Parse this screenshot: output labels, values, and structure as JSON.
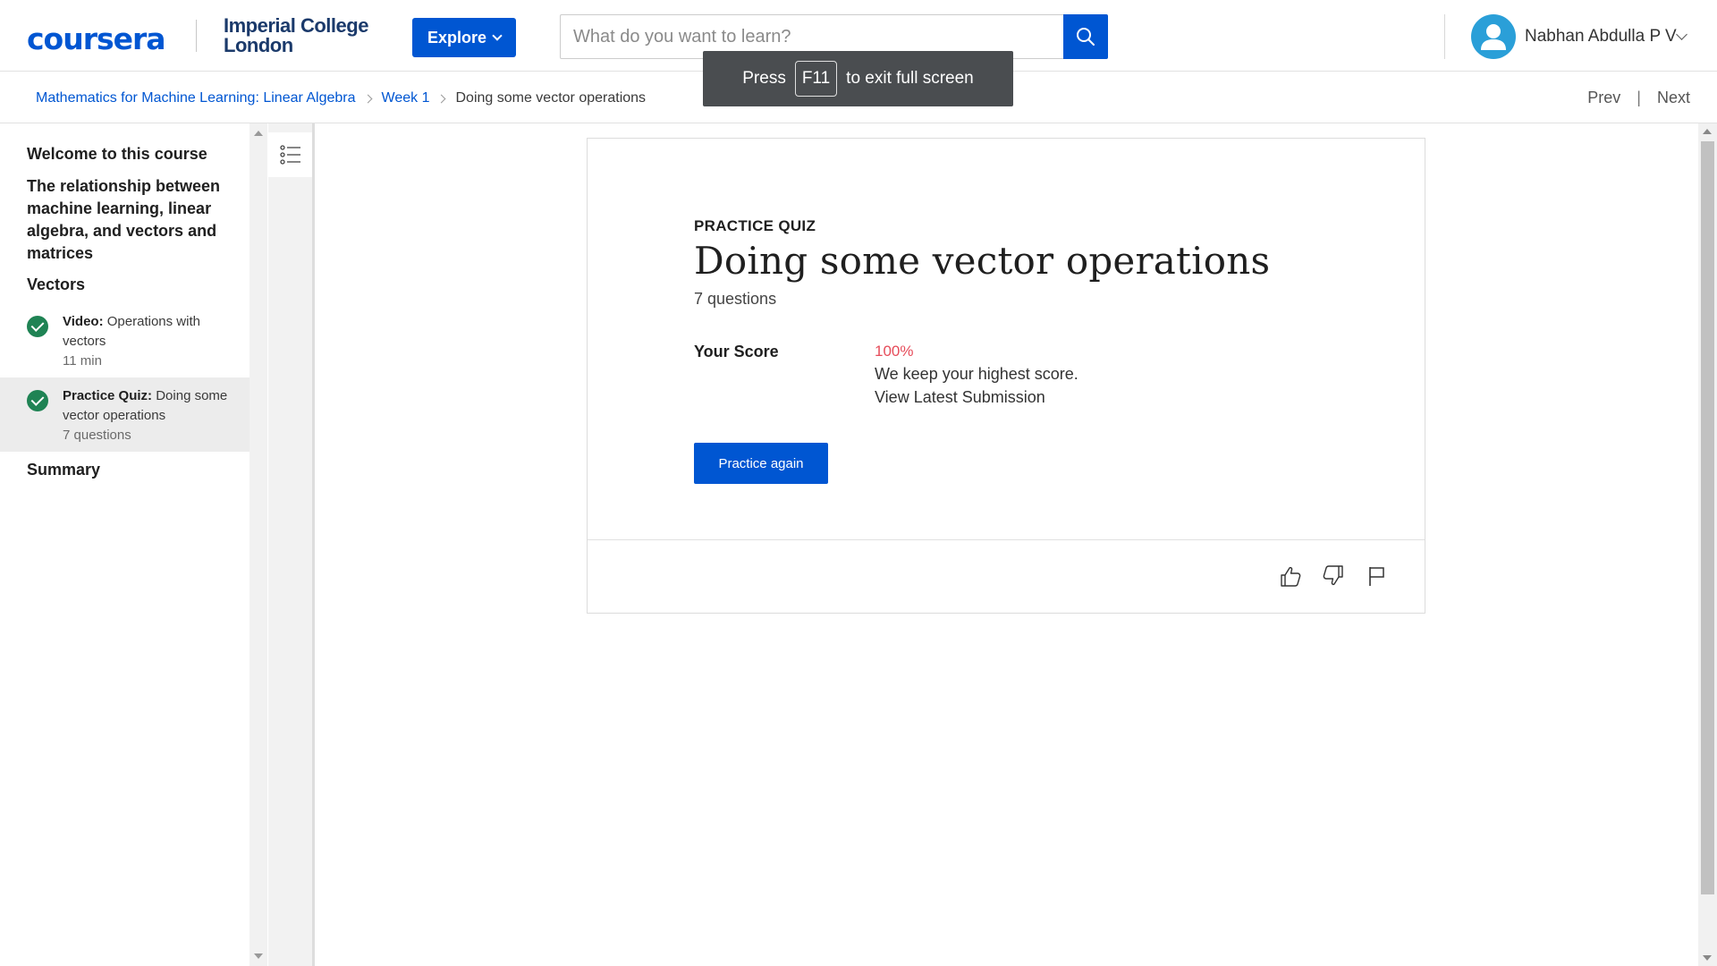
{
  "header": {
    "logo_text": "coursera",
    "partner_line1": "Imperial College",
    "partner_line2": "London",
    "explore_label": "Explore",
    "search_placeholder": "What do you want to learn?",
    "user_name": "Nabhan Abdulla P V"
  },
  "toast": {
    "before": "Press",
    "key": "F11",
    "after": "to exit full screen"
  },
  "breadcrumb": {
    "items": [
      "Mathematics for Machine Learning: Linear Algebra",
      "Week 1",
      "Doing some vector operations"
    ]
  },
  "pager": {
    "prev": "Prev",
    "separator": "|",
    "next": "Next"
  },
  "sidebar": {
    "welcome": "Welcome to this course",
    "section1": "The relationship between machine learning, linear algebra, and vectors and matrices",
    "section2": "Vectors",
    "items": [
      {
        "type": "Video:",
        "title": "Operations with vectors",
        "meta": "11 min",
        "completed": true
      },
      {
        "type": "Practice Quiz:",
        "title": "Doing some vector operations",
        "meta": "7 questions",
        "completed": true
      }
    ],
    "summary": "Summary"
  },
  "quiz": {
    "eyebrow": "PRACTICE QUIZ",
    "title": "Doing some vector operations",
    "question_count": "7 questions",
    "score_label": "Your Score",
    "score_value": "100%",
    "score_note": "We keep your highest score.",
    "submission_link": "View Latest Submission",
    "practice_button": "Practice again"
  },
  "colors": {
    "brand": "#0056d2",
    "score": "#e64c5a",
    "completed": "#1f8354"
  },
  "icons": {
    "search": "search-icon",
    "toc": "list-icon",
    "like": "thumbs-up-icon",
    "dislike": "thumbs-down-icon",
    "flag": "flag-icon"
  }
}
